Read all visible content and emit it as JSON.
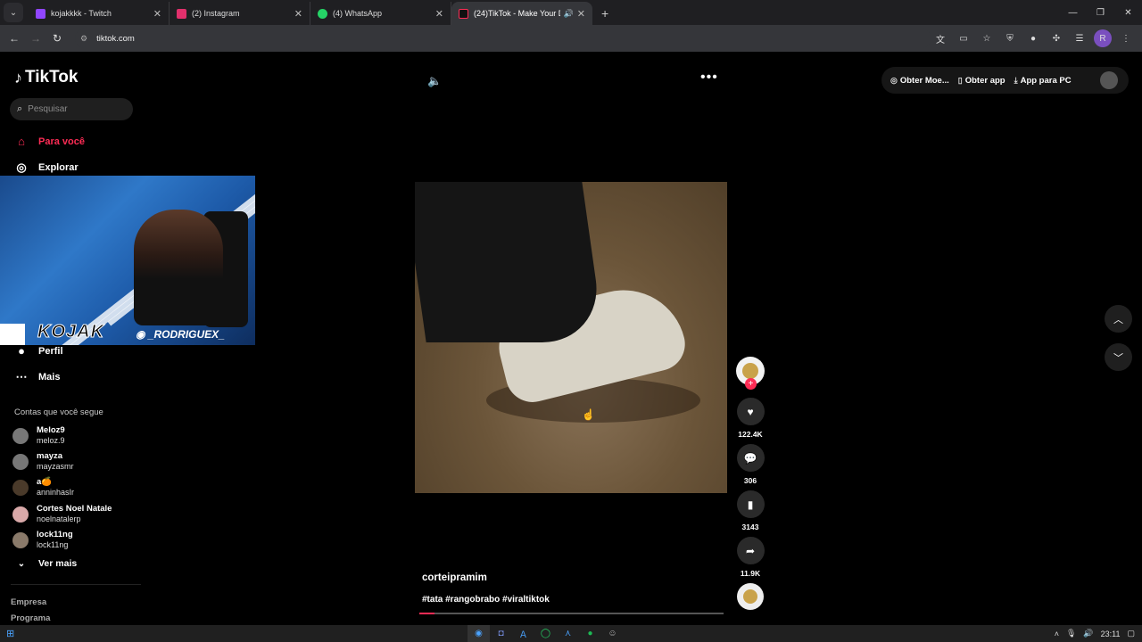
{
  "browser": {
    "tabs": [
      {
        "title": "kojakkkk - Twitch",
        "favicon_color": "#9146ff",
        "active": false
      },
      {
        "title": "(2) Instagram",
        "favicon_color": "#e1306c",
        "active": false
      },
      {
        "title": "(4) WhatsApp",
        "favicon_color": "#25d366",
        "active": false
      },
      {
        "title": "(24)TikTok - Make Your Day",
        "favicon_color": "#000000",
        "active": true
      }
    ],
    "url": "tiktok.com",
    "profile_initial": "R"
  },
  "sidebar": {
    "logo": "TikTok",
    "search_placeholder": "Pesquisar",
    "nav": [
      {
        "label": "Para você",
        "icon": "home-icon",
        "active": true
      },
      {
        "label": "Explorar",
        "icon": "compass-icon",
        "active": false
      },
      {
        "label": "Perfil",
        "icon": "profile-icon",
        "active": false
      },
      {
        "label": "Mais",
        "icon": "more-icon",
        "active": false
      }
    ],
    "following_title": "Contas que você segue",
    "accounts": [
      {
        "name": "Meloz9",
        "handle": "meloz.9"
      },
      {
        "name": "mayza",
        "handle": "mayzasmr"
      },
      {
        "name": "a🍊",
        "handle": "anninhasIr"
      },
      {
        "name": "Cortes Noel Natale",
        "handle": "noelnatalerp"
      },
      {
        "name": "lock11ng",
        "handle": "lock11ng"
      }
    ],
    "see_more": "Ver mais",
    "footer": [
      "Empresa",
      "Programa"
    ]
  },
  "webcam": {
    "brand": "KOJAK",
    "instagram": "_RODRIGUEX_"
  },
  "video": {
    "username": "corteipramim",
    "hashtags": "#tata #rangobrabo #viraltiktok",
    "progress": 0.05,
    "likes": "122.4K",
    "comments": "306",
    "saves": "3143",
    "shares": "11.9K"
  },
  "top_actions": {
    "coins": "Obter Moe...",
    "app": "Obter app",
    "pc": "App para PC"
  },
  "taskbar": {
    "time": "23:11"
  },
  "colors": {
    "accent": "#fe2c55",
    "background": "#000000"
  }
}
